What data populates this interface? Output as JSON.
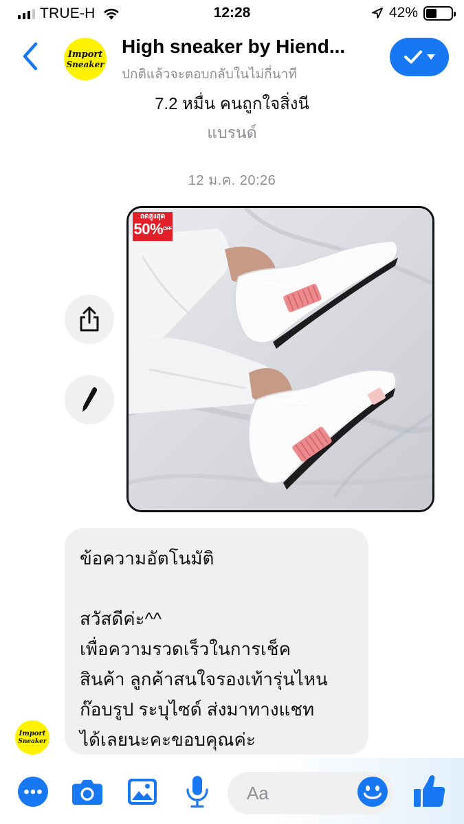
{
  "status_bar": {
    "carrier": "TRUE-H",
    "time": "12:28",
    "battery_percent": "42%",
    "battery_level": 0.42,
    "signal_bars_filled": 3,
    "icons": [
      "signal-icon",
      "wifi-icon",
      "location-arrow-icon",
      "battery-icon"
    ]
  },
  "header": {
    "page_name": "High sneaker by Hiend...",
    "response_note": "ปกติแล้วจะตอบกลับในไม่กี่นาที",
    "avatar_line1": "Import",
    "avatar_line2": "Sneaker",
    "icons": [
      "back-chevron-icon",
      "check-icon",
      "caret-down-icon"
    ]
  },
  "thread": {
    "likes": "7.2 หมื่น คนถูกใจสิ่งนี",
    "category": "แบรนด์",
    "timestamp": "12 ม.ค. 20:26",
    "photo": {
      "badge_top": "ลดสูงสุด",
      "badge_value": "50%",
      "badge_small": "OFF",
      "description_icon": "sneaker-photo"
    },
    "side_actions": [
      "share-icon",
      "edit-pen-icon"
    ],
    "message": {
      "line1": "ข้อความอัตโนมัติ",
      "line2": "สวัสดีค่ะ^^",
      "line3": "เพื่อความรวดเร็วในการเช็ค",
      "line4": "สินค้า ลูกค้าสนใจรองเท้ารุ่นไหน",
      "line5": "ก๊อบรูป ระบุไซด์ ส่งมาทางแชท",
      "line6": "ได้เลยนะคะขอบคุณค่ะ"
    }
  },
  "composer": {
    "placeholder": "Aa",
    "icons": [
      "more-dots-icon",
      "camera-icon",
      "gallery-icon",
      "microphone-icon",
      "emoji-icon",
      "thumbs-up-icon"
    ],
    "accent": "#1877f2"
  },
  "colors": {
    "accent": "#1877f2",
    "bubble": "#f0f0f0",
    "muted": "#8e8e93",
    "avatar": "#fff200",
    "badge": "#e3202a"
  }
}
